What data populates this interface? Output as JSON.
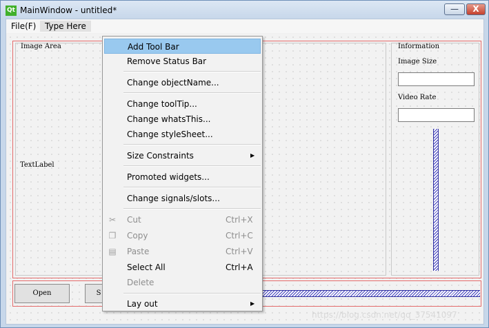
{
  "window": {
    "logo": "Qt",
    "title": "MainWindow - untitled*",
    "minimize_glyph": "—",
    "close_glyph": "X"
  },
  "menubar": {
    "items": [
      "File(F)",
      "Type Here"
    ]
  },
  "form": {
    "image_area_title": "Image Area",
    "text_label": "TextLabel",
    "information_title": "Information",
    "image_size_label": "Image Size",
    "video_rate_label": "Video Rate",
    "open_button": "Open",
    "second_button_partial": "S"
  },
  "context_menu": {
    "items": [
      {
        "label": "Add Tool Bar",
        "state": "highlighted"
      },
      {
        "label": "Remove Status Bar"
      },
      {
        "label": "Change objectName..."
      },
      {
        "label": "Change toolTip..."
      },
      {
        "label": "Change whatsThis..."
      },
      {
        "label": "Change styleSheet..."
      },
      {
        "label": "Size Constraints",
        "submenu": true
      },
      {
        "label": "Promoted widgets..."
      },
      {
        "label": "Change signals/slots..."
      },
      {
        "label": "Cut",
        "shortcut": "Ctrl+X",
        "disabled": true,
        "icon": "scissors-icon"
      },
      {
        "label": "Copy",
        "shortcut": "Ctrl+C",
        "disabled": true,
        "icon": "copy-icon"
      },
      {
        "label": "Paste",
        "shortcut": "Ctrl+V",
        "disabled": true,
        "icon": "paste-icon"
      },
      {
        "label": "Select All",
        "shortcut": "Ctrl+A"
      },
      {
        "label": "Delete",
        "disabled": true
      },
      {
        "label": "Lay out",
        "submenu": true
      }
    ],
    "submenu_glyph": "▶"
  },
  "watermark": "https://blog.csdn.net/qq_37541097",
  "colors": {
    "highlight": "#99c9ef",
    "layout_border": "#e46a6a",
    "slider": "#3b3bbd"
  }
}
